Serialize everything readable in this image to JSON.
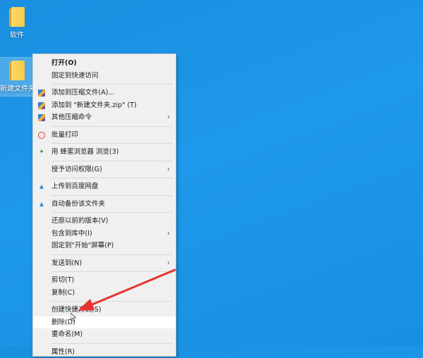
{
  "desktop": {
    "icons": [
      {
        "label": "软件"
      },
      {
        "label": "新建文件夹"
      }
    ]
  },
  "context_menu": {
    "items": [
      {
        "label": "打开(O)"
      },
      {
        "label": "固定到快速访问"
      },
      {
        "label": "添加到压缩文件(A)..."
      },
      {
        "label": "添加到 \"新建文件夹.zip\" (T)"
      },
      {
        "label": "其他压缩命令"
      },
      {
        "label": "批量打印"
      },
      {
        "label": "用 蜂蜜浏览器 浏览(3)"
      },
      {
        "label": "授予访问权限(G)"
      },
      {
        "label": "上传到百度网盘"
      },
      {
        "label": "自动备份该文件夹"
      },
      {
        "label": "还原以前的版本(V)"
      },
      {
        "label": "包含到库中(I)"
      },
      {
        "label": "固定到\"开始\"屏幕(P)"
      },
      {
        "label": "发送到(N)"
      },
      {
        "label": "剪切(T)"
      },
      {
        "label": "复制(C)"
      },
      {
        "label": "创建快捷方式(S)"
      },
      {
        "label": "删除(D)"
      },
      {
        "label": "重命名(M)"
      },
      {
        "label": "属性(R)"
      }
    ],
    "submenu_arrow": "›"
  },
  "annotation": {
    "color": "#e8322f"
  }
}
